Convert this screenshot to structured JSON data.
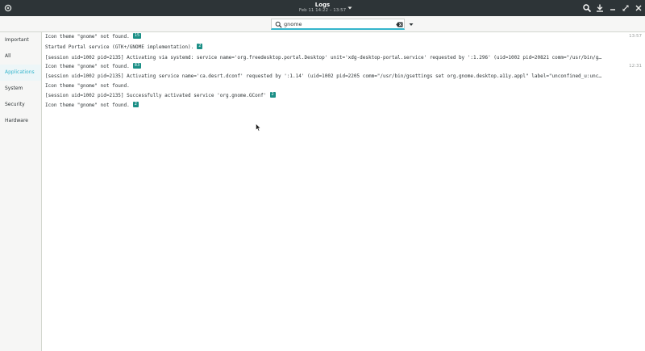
{
  "window": {
    "title": "Logs",
    "subtitle": "Feb 11 14:22 – 13:57"
  },
  "search": {
    "value": "gnome"
  },
  "sidebar": {
    "items": [
      {
        "label": "Important",
        "active": false
      },
      {
        "label": "All",
        "active": false
      },
      {
        "label": "Applications",
        "active": true
      },
      {
        "label": "System",
        "active": false
      },
      {
        "label": "Security",
        "active": false
      },
      {
        "label": "Hardware",
        "active": false
      }
    ]
  },
  "logs": [
    {
      "text": "Icon theme \"gnome\" not found.",
      "badge": "15",
      "time": "13:57"
    },
    {
      "text": "Started Portal service (GTK+/GNOME implementation).",
      "badge": "2",
      "time": ""
    },
    {
      "text": "[session uid=1002 pid=2135] Activating via systemd: service name='org.freedesktop.portal.Desktop' unit='xdg-desktop-portal.service' requested by ':1.296' (uid=1002 pid=20821 comm=\"/usr/bin/g…",
      "badge": "",
      "time": ""
    },
    {
      "text": "Icon theme \"gnome\" not found.",
      "badge": "83",
      "time": "12:31"
    },
    {
      "text": "[session uid=1002 pid=2135] Activating service name='ca.desrt.dconf' requested by ':1.14' (uid=1002 pid=2205 comm=\"/usr/bin/gsettings set org.gnome.desktop.a11y.appl\" label=\"unconfined_u:unc…",
      "badge": "",
      "time": ""
    },
    {
      "text": "Icon theme \"gnome\" not found.",
      "badge": "",
      "time": ""
    },
    {
      "text": "[session uid=1002 pid=2135] Successfully activated service 'org.gnome.GConf'",
      "badge": "2",
      "time": ""
    },
    {
      "text": "Icon theme \"gnome\" not found.",
      "badge": "2",
      "time": ""
    }
  ],
  "colors": {
    "titlebar": "#2d3437",
    "accent": "#33b5cc",
    "badge": "#1b8f86"
  }
}
